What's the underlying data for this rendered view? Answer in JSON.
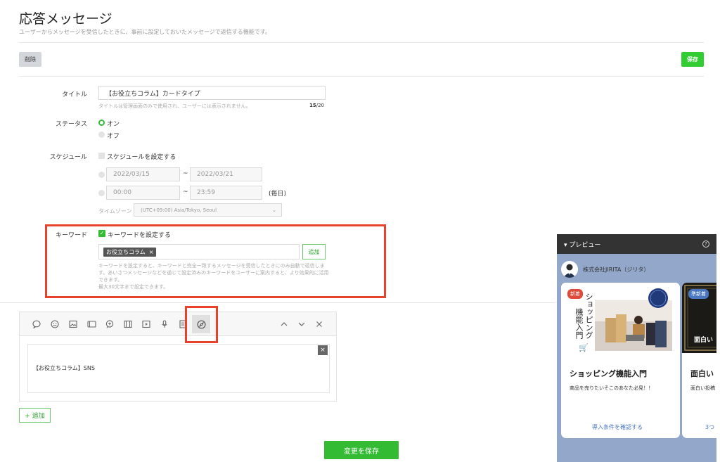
{
  "header": {
    "title": "応答メッセージ",
    "description": "ユーザーからメッセージを受信したときに、事前に設定しておいたメッセージで返信する機能です。"
  },
  "actions": {
    "delete_label": "削除",
    "save_label": "保存"
  },
  "form": {
    "title_label": "タイトル",
    "title_value": "【お役立ちコラム】カードタイプ",
    "title_hint": "タイトルは管理画面のみで使用され、ユーザーには表示されません。",
    "title_count": "15",
    "title_max": "/20",
    "status_label": "ステータス",
    "status_on": "オン",
    "status_off": "オフ",
    "schedule_label": "スケジュール",
    "schedule_checkbox": "スケジュールを設定する",
    "date_start": "2022/03/15",
    "date_end": "2022/03/21",
    "time_start": "00:00",
    "time_end": "23:59",
    "range_sep": "~",
    "daily_label": "(毎日)",
    "timezone_label": "タイムゾーン :",
    "timezone_value": "(UTC+09:00) Asia/Tokyo, Seoul",
    "keyword_label": "キーワード",
    "keyword_checkbox": "キーワードを設定する",
    "keyword_tag": "お役立ちコラム",
    "keyword_tag_remove": "×",
    "keyword_add": "追加",
    "keyword_help_1": "キーワードを設定すると、キーワードと完全一致するメッセージを受信したときにのみ自動で返信しま",
    "keyword_help_2": "す。あいさつメッセージなどを通じて設定済みのキーワードをユーザーに案内すると、より効果的に活用",
    "keyword_help_3": "できます。",
    "keyword_help_4": "最大30文字まで設定できます。"
  },
  "editor": {
    "message_text": "【お役立ちコラム】SNS",
    "close_symbol": "×",
    "tools": [
      "chat-bubble-icon",
      "emoji-icon",
      "image-icon",
      "card-icon",
      "rich-message-icon",
      "video-icon",
      "play-icon",
      "microphone-icon",
      "coupon-icon",
      "compass-icon"
    ],
    "nav": [
      "chevron-up-icon",
      "chevron-down-icon",
      "close-icon"
    ]
  },
  "footer": {
    "add_label": "+ 追加",
    "save_changes_label": "変更を保存"
  },
  "preview": {
    "header_label": "▾ プレビュー",
    "help_symbol": "?",
    "account_name": "株式会社JIRITA（ジリタ）",
    "card1": {
      "badge": "新着",
      "image_text_1": "ショッピング",
      "image_text_2": "機能入門",
      "title": "ショッピング機能入門",
      "description": "商品を売りたいそこのあなた必見！！",
      "link": "導入条件を確認する"
    },
    "card2": {
      "badge": "準新着",
      "image_text": "面白い",
      "title": "面白い",
      "description": "面白い投稿",
      "link": "3つ"
    }
  },
  "colors": {
    "accent_green": "#33bb33",
    "highlight_red": "#e8412c",
    "preview_bg": "#92a7c9"
  }
}
